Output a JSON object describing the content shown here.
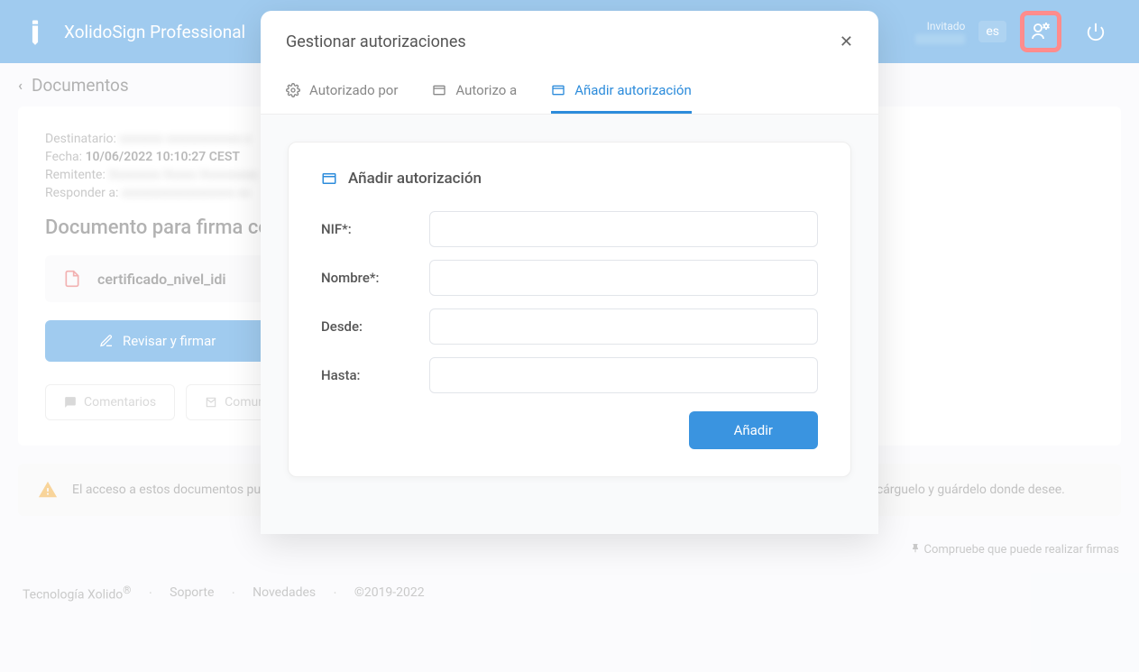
{
  "header": {
    "app_title": "XolidoSign Professional",
    "user_status": "Invitado",
    "lang": "es"
  },
  "breadcrumb": {
    "label": "Documentos"
  },
  "meta": {
    "destinatario_label": "Destinatario:",
    "fecha_label": "Fecha:",
    "fecha_value": "10/06/2022 10:10:27 CEST",
    "remitente_label": "Remitente:",
    "responder_label": "Responder a:"
  },
  "document": {
    "title": "Documento para firma co",
    "filename": "certificado_nivel_idi"
  },
  "buttons": {
    "review_sign": "Revisar y firmar",
    "comments": "Comentarios",
    "comunic": "Comun"
  },
  "info": {
    "text_start": "El acceso a estos documentos pu",
    "text_end": "to de forma permanente, descárguelo y guárdelo donde desee."
  },
  "hint": {
    "text": "Compruebe que puede realizar firmas"
  },
  "footer": {
    "tech": "Tecnología Xolido",
    "support": "Soporte",
    "news": "Novedades",
    "copyright": "©2019-2022"
  },
  "modal": {
    "title": "Gestionar autorizaciones",
    "tabs": {
      "authorized_by": "Autorizado por",
      "authorize_to": "Autorizo a",
      "add_auth": "Añadir autorización"
    },
    "form": {
      "title": "Añadir autorización",
      "nif": "NIF*:",
      "nombre": "Nombre*:",
      "desde": "Desde:",
      "hasta": "Hasta:",
      "add_btn": "Añadir"
    }
  }
}
